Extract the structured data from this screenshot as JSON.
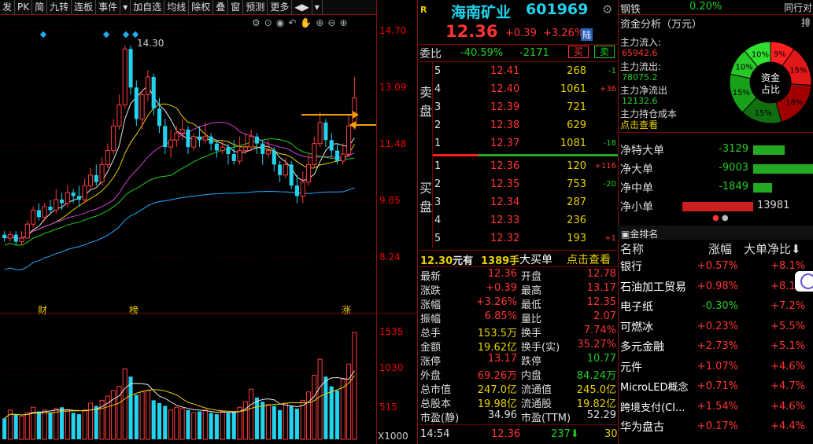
{
  "toolbar": {
    "items": [
      "发",
      "PK",
      "简",
      "九转",
      "连板",
      "事件",
      "▾",
      "加自选",
      "均线",
      "除权",
      "叠",
      "窗",
      "预测",
      "更多",
      "◀▶",
      "▾"
    ]
  },
  "chart": {
    "price_axis": [
      "14.70",
      "13.09",
      "11.48",
      "9.85",
      "8.24"
    ],
    "volume_axis": [
      "1535",
      "1030",
      "515"
    ],
    "volume_unit": "X1000",
    "high_label": "14.30",
    "markers": [
      "财",
      "榜",
      "涨"
    ]
  },
  "chart_data": {
    "type": "candlestick",
    "candles": [
      {
        "o": 8.9,
        "c": 8.8,
        "h": 9.0,
        "l": 8.7
      },
      {
        "o": 8.8,
        "c": 8.9,
        "h": 9.0,
        "l": 8.7
      },
      {
        "o": 8.9,
        "c": 8.7,
        "h": 9.0,
        "l": 8.6
      },
      {
        "o": 8.7,
        "c": 8.8,
        "h": 9.0,
        "l": 8.6
      },
      {
        "o": 8.8,
        "c": 9.2,
        "h": 9.3,
        "l": 8.8
      },
      {
        "o": 9.2,
        "c": 9.6,
        "h": 9.7,
        "l": 9.1
      },
      {
        "o": 9.6,
        "c": 9.4,
        "h": 9.8,
        "l": 9.3
      },
      {
        "o": 9.4,
        "c": 9.7,
        "h": 9.8,
        "l": 9.3
      },
      {
        "o": 9.7,
        "c": 9.6,
        "h": 9.9,
        "l": 9.5
      },
      {
        "o": 9.6,
        "c": 9.9,
        "h": 10.2,
        "l": 9.5
      },
      {
        "o": 9.9,
        "c": 9.8,
        "h": 10.1,
        "l": 9.6
      },
      {
        "o": 9.8,
        "c": 10.1,
        "h": 10.3,
        "l": 9.7
      },
      {
        "o": 10.1,
        "c": 10.0,
        "h": 10.2,
        "l": 9.8
      },
      {
        "o": 10.0,
        "c": 9.9,
        "h": 10.3,
        "l": 9.7
      },
      {
        "o": 9.9,
        "c": 10.3,
        "h": 10.5,
        "l": 9.8
      },
      {
        "o": 10.3,
        "c": 10.6,
        "h": 10.8,
        "l": 10.2
      },
      {
        "o": 10.6,
        "c": 10.4,
        "h": 10.9,
        "l": 10.3
      },
      {
        "o": 10.4,
        "c": 10.9,
        "h": 11.1,
        "l": 10.3
      },
      {
        "o": 10.9,
        "c": 11.3,
        "h": 11.5,
        "l": 10.8
      },
      {
        "o": 11.3,
        "c": 12.0,
        "h": 12.2,
        "l": 11.2
      },
      {
        "o": 12.0,
        "c": 12.6,
        "h": 12.9,
        "l": 11.9
      },
      {
        "o": 12.6,
        "c": 14.2,
        "h": 14.3,
        "l": 12.5
      },
      {
        "o": 14.2,
        "c": 13.1,
        "h": 14.3,
        "l": 12.9
      },
      {
        "o": 13.1,
        "c": 12.2,
        "h": 13.3,
        "l": 12.0
      },
      {
        "o": 12.2,
        "c": 12.9,
        "h": 13.0,
        "l": 11.9
      },
      {
        "o": 12.9,
        "c": 13.4,
        "h": 13.6,
        "l": 12.7
      },
      {
        "o": 13.4,
        "c": 12.5,
        "h": 13.5,
        "l": 12.3
      },
      {
        "o": 12.5,
        "c": 12.0,
        "h": 12.8,
        "l": 11.8
      },
      {
        "o": 12.0,
        "c": 11.4,
        "h": 12.2,
        "l": 11.2
      },
      {
        "o": 11.4,
        "c": 11.6,
        "h": 11.9,
        "l": 11.1
      },
      {
        "o": 11.6,
        "c": 11.8,
        "h": 12.0,
        "l": 11.4
      },
      {
        "o": 11.8,
        "c": 11.9,
        "h": 12.2,
        "l": 11.6
      },
      {
        "o": 11.9,
        "c": 11.4,
        "h": 12.0,
        "l": 11.2
      },
      {
        "o": 11.4,
        "c": 11.7,
        "h": 11.8,
        "l": 11.3
      },
      {
        "o": 11.7,
        "c": 11.6,
        "h": 12.0,
        "l": 11.4
      },
      {
        "o": 11.6,
        "c": 11.7,
        "h": 12.1,
        "l": 11.5
      },
      {
        "o": 11.7,
        "c": 11.5,
        "h": 11.8,
        "l": 11.3
      },
      {
        "o": 11.5,
        "c": 11.3,
        "h": 11.6,
        "l": 11.1
      },
      {
        "o": 11.3,
        "c": 11.4,
        "h": 11.6,
        "l": 11.2
      },
      {
        "o": 11.4,
        "c": 11.2,
        "h": 11.5,
        "l": 10.9
      },
      {
        "o": 11.2,
        "c": 11.0,
        "h": 11.6,
        "l": 10.9
      },
      {
        "o": 11.0,
        "c": 11.3,
        "h": 11.7,
        "l": 10.9
      },
      {
        "o": 11.3,
        "c": 11.4,
        "h": 11.8,
        "l": 11.2
      },
      {
        "o": 11.4,
        "c": 11.7,
        "h": 11.9,
        "l": 11.3
      },
      {
        "o": 11.7,
        "c": 11.5,
        "h": 11.8,
        "l": 11.2
      },
      {
        "o": 11.5,
        "c": 11.2,
        "h": 11.6,
        "l": 10.9
      },
      {
        "o": 11.2,
        "c": 11.3,
        "h": 11.6,
        "l": 11.1
      },
      {
        "o": 11.3,
        "c": 10.9,
        "h": 11.4,
        "l": 10.7
      },
      {
        "o": 10.9,
        "c": 10.6,
        "h": 11.0,
        "l": 10.4
      },
      {
        "o": 10.6,
        "c": 10.9,
        "h": 11.1,
        "l": 10.5
      },
      {
        "o": 10.9,
        "c": 10.3,
        "h": 11.0,
        "l": 10.2
      },
      {
        "o": 10.3,
        "c": 10.0,
        "h": 10.6,
        "l": 9.8
      },
      {
        "o": 10.0,
        "c": 10.4,
        "h": 10.7,
        "l": 9.8
      },
      {
        "o": 10.4,
        "c": 10.9,
        "h": 11.2,
        "l": 10.3
      },
      {
        "o": 10.9,
        "c": 11.5,
        "h": 11.7,
        "l": 10.8
      },
      {
        "o": 11.5,
        "c": 12.1,
        "h": 12.4,
        "l": 11.4
      },
      {
        "o": 12.1,
        "c": 11.6,
        "h": 12.2,
        "l": 11.4
      },
      {
        "o": 11.6,
        "c": 11.3,
        "h": 11.8,
        "l": 11.1
      },
      {
        "o": 11.3,
        "c": 11.0,
        "h": 11.5,
        "l": 10.9
      },
      {
        "o": 11.0,
        "c": 11.2,
        "h": 11.5,
        "l": 10.9
      },
      {
        "o": 11.2,
        "c": 12.0,
        "h": 12.3,
        "l": 11.1
      },
      {
        "o": 12.0,
        "c": 12.8,
        "h": 13.4,
        "l": 11.9
      }
    ],
    "volumes": [
      300,
      420,
      350,
      330,
      380,
      460,
      400,
      420,
      380,
      440,
      460,
      420,
      380,
      360,
      420,
      520,
      480,
      560,
      620,
      700,
      760,
      1010,
      900,
      640,
      680,
      700,
      560,
      520,
      480,
      420,
      460,
      440,
      420,
      380,
      400,
      420,
      380,
      360,
      400,
      380,
      400,
      460,
      540,
      720,
      600,
      540,
      500,
      480,
      420,
      520,
      480,
      440,
      560,
      680,
      920,
      1150,
      900,
      760,
      700,
      860,
      1080,
      1535
    ]
  },
  "quote": {
    "badge": "R",
    "name": "海南矿业",
    "code": "601969",
    "price": "12.36",
    "change": "+0.39",
    "change_pct": "+3.26%",
    "exchange_tag": "陆",
    "weibi_label": "委比",
    "weibi": "-40.59%",
    "weicha": "-2171",
    "buy_btn": "买",
    "sell_btn": "卖",
    "sell_label": "卖盘",
    "buy_label": "买盘",
    "sell": [
      {
        "lvl": "5",
        "price": "12.41",
        "vol": "268",
        "delta": "-1"
      },
      {
        "lvl": "4",
        "price": "12.40",
        "vol": "1061",
        "delta": "+36"
      },
      {
        "lvl": "3",
        "price": "12.39",
        "vol": "721",
        "delta": ""
      },
      {
        "lvl": "2",
        "price": "12.38",
        "vol": "629",
        "delta": ""
      },
      {
        "lvl": "1",
        "price": "12.37",
        "vol": "1081",
        "delta": "-18"
      }
    ],
    "buy": [
      {
        "lvl": "1",
        "price": "12.36",
        "vol": "120",
        "delta": "+116"
      },
      {
        "lvl": "2",
        "price": "12.35",
        "vol": "753",
        "delta": "-20"
      },
      {
        "lvl": "3",
        "price": "12.34",
        "vol": "287",
        "delta": ""
      },
      {
        "lvl": "4",
        "price": "12.33",
        "vol": "236",
        "delta": ""
      },
      {
        "lvl": "5",
        "price": "12.32",
        "vol": "193",
        "delta": "+1"
      }
    ],
    "bigorder": {
      "price": "12.30",
      "unit": "元有",
      "amount": "1389手",
      "label": "大买单",
      "link": "点击查看"
    },
    "stats": [
      [
        "最新",
        "12.36",
        "开盘",
        "12.78"
      ],
      [
        "涨跌",
        "+0.39",
        "最高",
        "13.17"
      ],
      [
        "涨幅",
        "+3.26%",
        "最低",
        "12.35"
      ],
      [
        "振幅",
        "6.85%",
        "量比",
        "2.07"
      ],
      [
        "总手",
        "153.5万",
        "换手",
        "7.74%"
      ],
      [
        "金额",
        "19.62亿",
        "换手(实)",
        "35.27%"
      ],
      [
        "涨停",
        "13.17",
        "跌停",
        "10.77"
      ],
      [
        "外盘",
        "69.26万",
        "内盘",
        "84.24万"
      ],
      [
        "总市值",
        "247.0亿",
        "流通值",
        "245.0亿"
      ],
      [
        "总股本",
        "19.98亿",
        "流通股",
        "19.82亿"
      ],
      [
        "市盈(静)",
        "34.96",
        "市盈(TTM)",
        "52.29"
      ]
    ],
    "tick": {
      "time": "14:54",
      "price": "12.36",
      "vol": "237",
      "num": "30"
    }
  },
  "right": {
    "sector_name": "钢铁",
    "sector_pct": "0.20%",
    "sector_tail": "同行对",
    "flow_title": "资金分析（万元）",
    "inflow_label": "主力流入:",
    "inflow": "65942.6",
    "outflow_label": "主力流出:",
    "outflow": "78075.2",
    "net_label": "主力净流出",
    "net": "12132.6",
    "cost_label": "主力持仓成本",
    "link": "点击查看",
    "donut_center": [
      "资金",
      "占比"
    ],
    "donut": [
      {
        "label": "9%",
        "value": 9,
        "color": "#ff2020"
      },
      {
        "label": "15%",
        "value": 15,
        "color": "#e01818"
      },
      {
        "label": "18%",
        "value": 18,
        "color": "#a00000"
      },
      {
        "label": "15%",
        "value": 15,
        "color": "#107010"
      },
      {
        "label": "15%",
        "value": 15,
        "color": "#18a018"
      },
      {
        "label": "10%",
        "value": 10,
        "color": "#28c828"
      },
      {
        "label": "10%",
        "value": 10,
        "color": "#30e030"
      }
    ],
    "net_flows": [
      {
        "label": "净特大单",
        "value": "-3129",
        "amount": -3129
      },
      {
        "label": "净大单",
        "value": "-9003",
        "amount": -9003
      },
      {
        "label": "净中单",
        "value": "-1849",
        "amount": -1849
      },
      {
        "label": "净小单",
        "value": "13981",
        "amount": 13981
      }
    ],
    "rank_title": "金排名",
    "rank_headers": [
      "名称",
      "涨幅",
      "大单净比"
    ],
    "sectors": [
      {
        "name": "银行",
        "pct": "+0.57%",
        "ratio": "+8.1%"
      },
      {
        "name": "石油加工贸易",
        "pct": "+0.98%",
        "ratio": "+8.1%"
      },
      {
        "name": "电子纸",
        "pct": "-0.30%",
        "ratio": "+7.2%"
      },
      {
        "name": "可燃冰",
        "pct": "+0.23%",
        "ratio": "+5.5%"
      },
      {
        "name": "多元金融",
        "pct": "+2.73%",
        "ratio": "+5.1%"
      },
      {
        "name": "元件",
        "pct": "+1.07%",
        "ratio": "+4.6%"
      },
      {
        "name": "MicroLED概念",
        "pct": "+0.71%",
        "ratio": "+4.7%"
      },
      {
        "name": "跨境支付(CI...",
        "pct": "+1.54%",
        "ratio": "+4.6%"
      },
      {
        "name": "华为盘古",
        "pct": "+0.17%",
        "ratio": "+4.4%"
      }
    ]
  }
}
